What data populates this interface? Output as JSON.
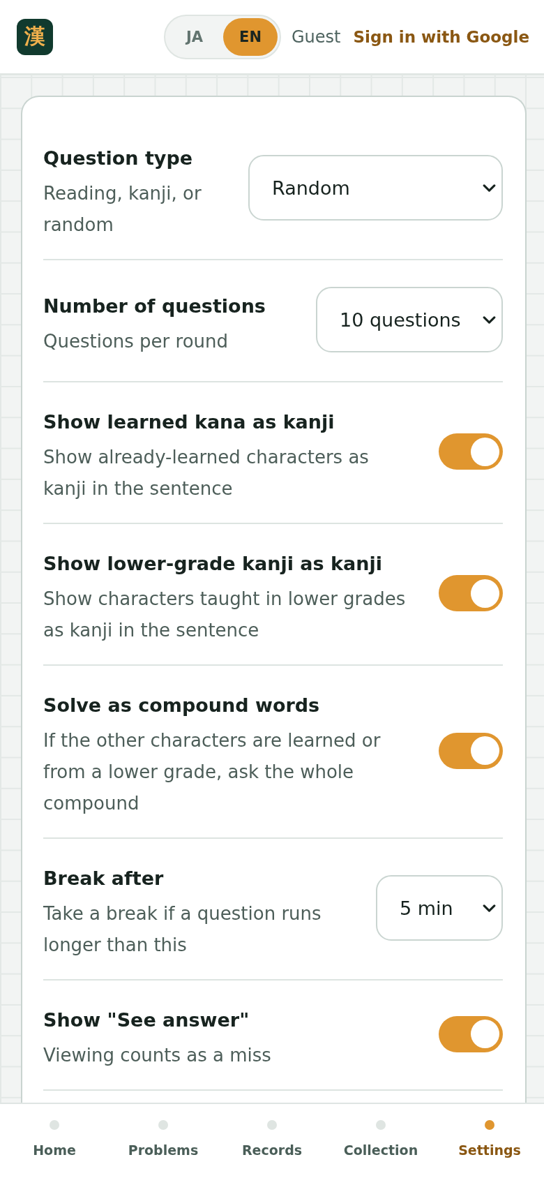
{
  "header": {
    "logo": "漢",
    "language_toggle": [
      {
        "label": "JA",
        "selected": false
      },
      {
        "label": "EN",
        "selected": true
      }
    ],
    "user": "Guest",
    "sign_in_link": "Sign in with Google"
  },
  "settings": [
    {
      "kind": "select",
      "title": "Question type",
      "description": "Reading, kanji, or random",
      "value": "Random"
    },
    {
      "kind": "select",
      "title": "Number of questions",
      "description": "Questions per round",
      "value": "10 questions"
    },
    {
      "kind": "toggle",
      "title": "Show learned kana as kanji",
      "description": "Show already-learned characters as kanji in the sentence",
      "on": true
    },
    {
      "kind": "toggle",
      "title": "Show lower-grade kanji as kanji",
      "description": "Show characters taught in lower grades as kanji in the sentence",
      "on": true
    },
    {
      "kind": "toggle",
      "title": "Solve as compound words",
      "description": "If the other characters are learned or from a lower grade, ask the whole compound",
      "on": true
    },
    {
      "kind": "select",
      "title": "Break after",
      "description": "Take a break if a question runs longer than this",
      "value": "5 min"
    },
    {
      "kind": "toggle",
      "title": "Show \"See answer\"",
      "description": "Viewing counts as a miss",
      "on": true
    }
  ],
  "bottom_nav": [
    {
      "label": "Home",
      "selected": false
    },
    {
      "label": "Problems",
      "selected": false
    },
    {
      "label": "Records",
      "selected": false
    },
    {
      "label": "Collection",
      "selected": false
    },
    {
      "label": "Settings",
      "selected": true
    }
  ]
}
